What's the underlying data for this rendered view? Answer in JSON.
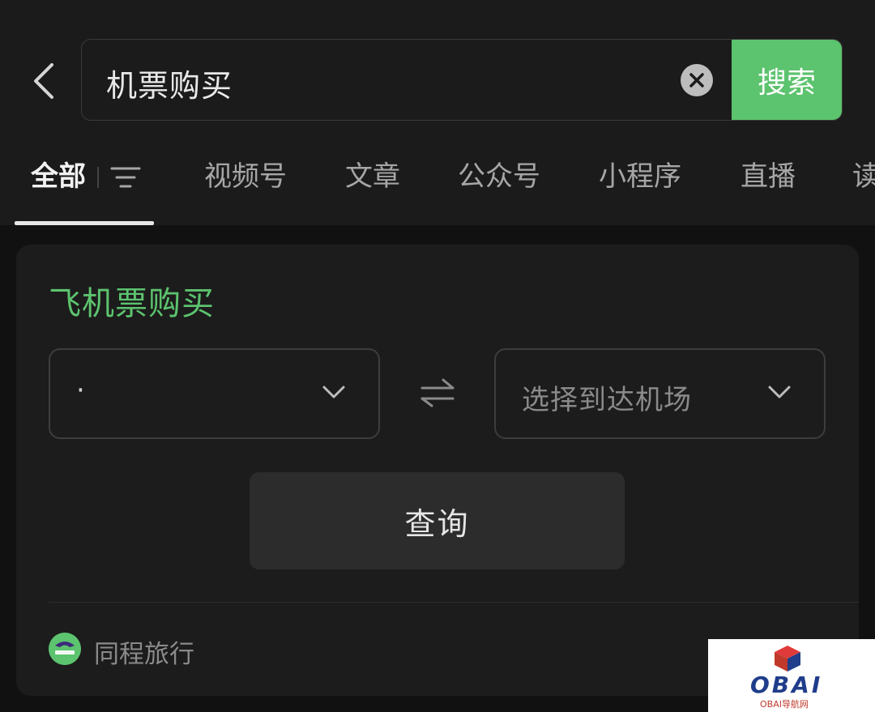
{
  "header": {
    "search_value": "机票购买",
    "search_button": "搜索"
  },
  "tabs": [
    {
      "label": "全部"
    },
    {
      "label": "视频号"
    },
    {
      "label": "文章"
    },
    {
      "label": "公众号"
    },
    {
      "label": "小程序"
    },
    {
      "label": "直播"
    },
    {
      "label": "读"
    }
  ],
  "card": {
    "title": "飞机票购买",
    "from_value": "·",
    "to_placeholder": "选择到达机场",
    "query_button": "查询",
    "provider": "同程旅行",
    "provider_logo_text": "同程旅行"
  },
  "watermark": {
    "text": "OBAI",
    "subtext": "OBAI导航网"
  },
  "colors": {
    "accent": "#5cc36e",
    "background": "#111111",
    "surface": "#1c1c1c"
  },
  "icons": [
    "back-arrow-icon",
    "clear-icon",
    "filter-icon",
    "chevron-down-icon",
    "swap-icon"
  ]
}
